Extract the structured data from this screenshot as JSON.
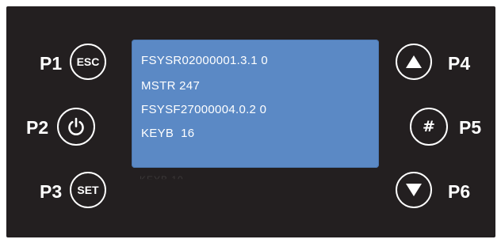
{
  "labels": {
    "p1": "P1",
    "p2": "P2",
    "p3": "P3",
    "p4": "P4",
    "p5": "P5",
    "p6": "P6"
  },
  "buttons": {
    "esc": "ESC",
    "set": "SET",
    "hash": "#"
  },
  "icons": {
    "p2": "power-icon",
    "p4": "triangle-up-icon",
    "p6": "triangle-down-icon"
  },
  "display": {
    "lines": [
      "FSYSR02000001.3.1 0",
      "MSTR 247",
      "FSYSF27000004.0.2 0",
      "KEYB  16"
    ],
    "cut_off_line": "KEYB  10"
  },
  "colors": {
    "panel": "#231f20",
    "screen": "#5b89c5",
    "text": "#ffffff"
  }
}
